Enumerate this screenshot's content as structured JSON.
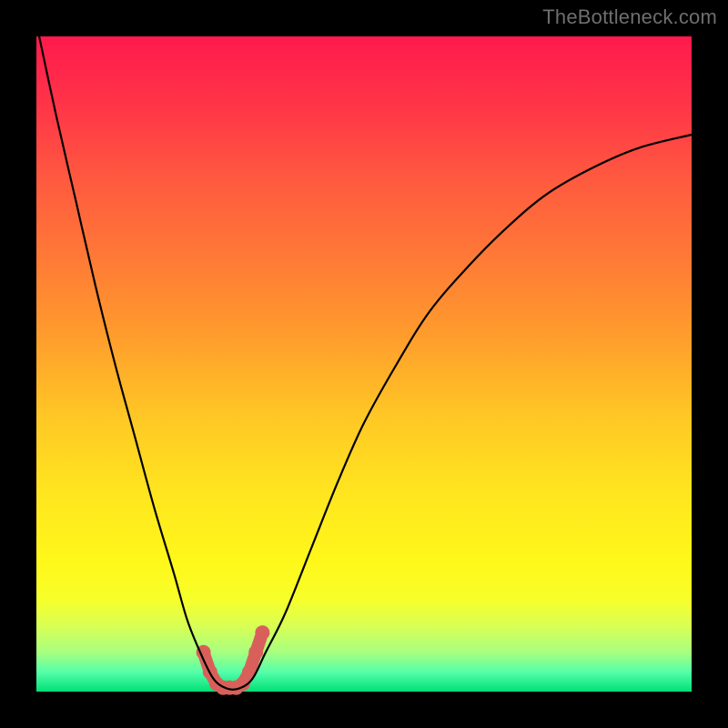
{
  "watermark": "TheBottleneck.com",
  "chart_data": {
    "type": "line",
    "title": "",
    "xlabel": "",
    "ylabel": "",
    "xlim": [
      0,
      100
    ],
    "ylim": [
      0,
      100
    ],
    "grid": false,
    "series": [
      {
        "name": "bottleneck-curve",
        "x": [
          0,
          3,
          6,
          9,
          12,
          15,
          18,
          21,
          23,
          25,
          27,
          29,
          31,
          33,
          35,
          38,
          42,
          46,
          50,
          55,
          60,
          66,
          72,
          78,
          85,
          92,
          100
        ],
        "y": [
          102,
          88,
          75,
          62,
          50,
          39,
          28,
          18,
          11,
          6,
          2,
          0.5,
          0.5,
          2,
          6,
          12,
          22,
          32,
          41,
          50,
          58,
          65,
          71,
          76,
          80,
          83,
          85
        ]
      },
      {
        "name": "fit-marker",
        "x": [
          25.5,
          26.5,
          27.5,
          28.5,
          29.5,
          30.5,
          31.5,
          32.5,
          33.5,
          34.5
        ],
        "y": [
          6,
          3,
          1.2,
          0.6,
          0.6,
          0.6,
          1.2,
          3,
          6,
          9
        ]
      }
    ],
    "colors": {
      "curve": "#000000",
      "marker": "#d9605a"
    }
  }
}
